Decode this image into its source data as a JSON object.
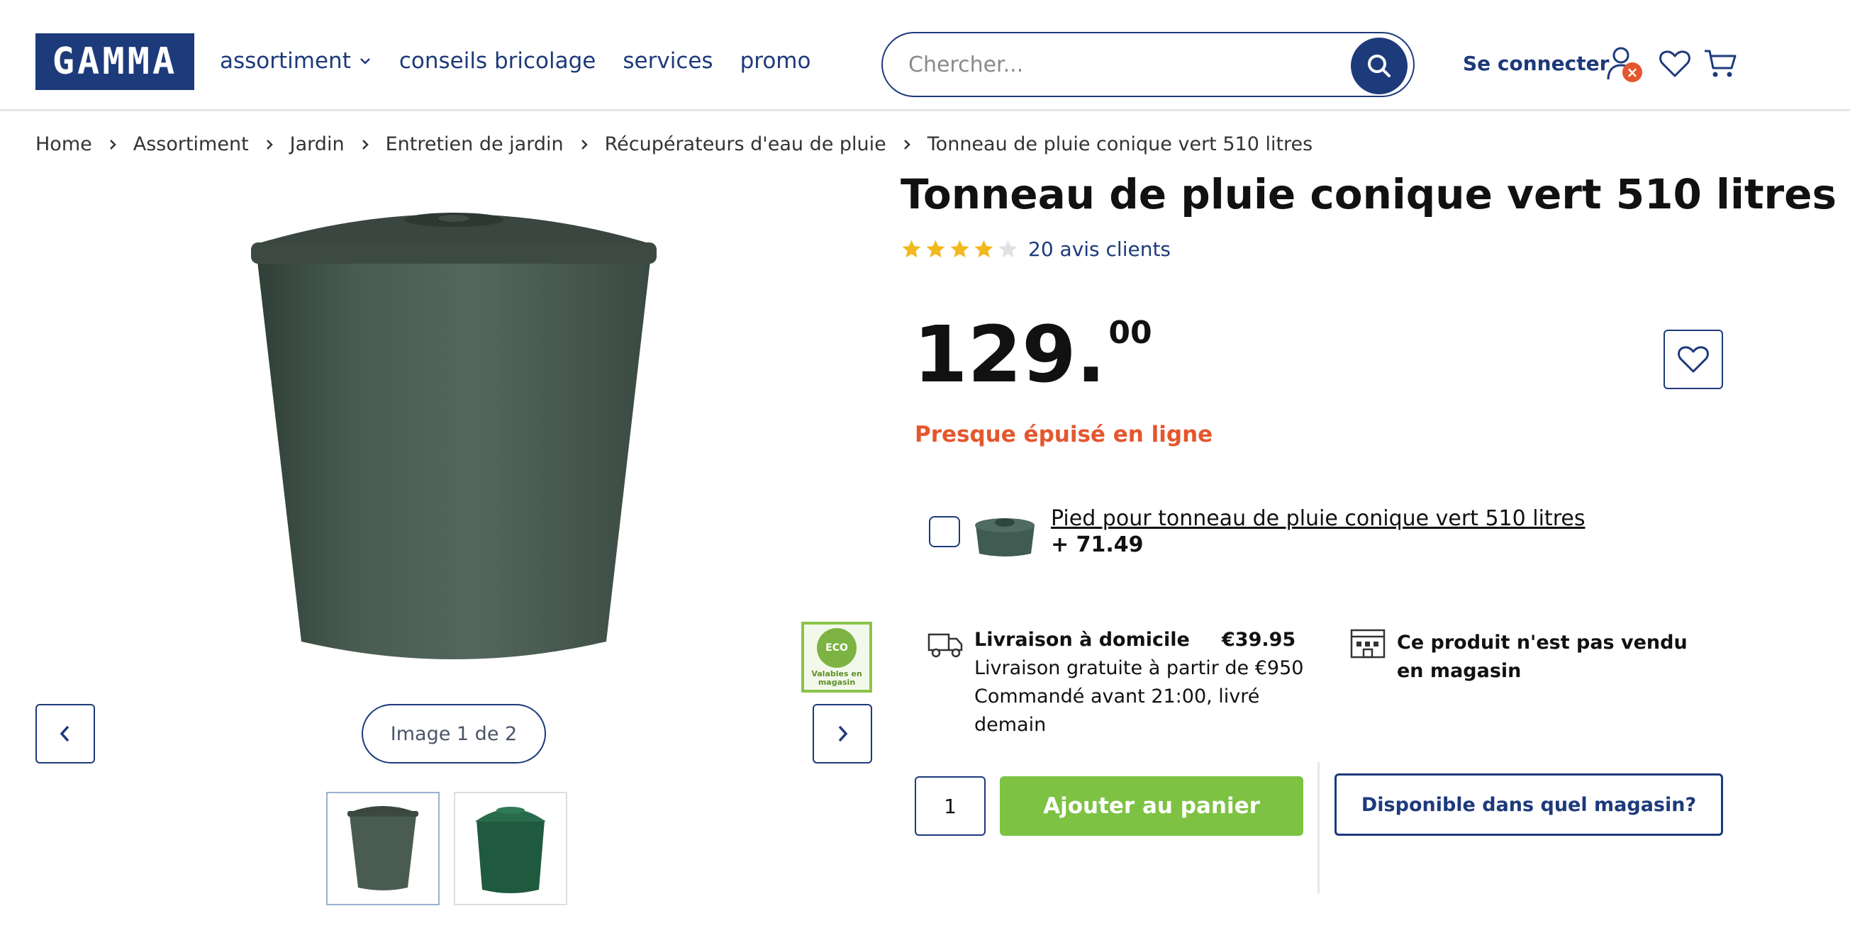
{
  "header": {
    "logo_text": "GAMMA",
    "nav": [
      {
        "label": "assortiment"
      },
      {
        "label": "conseils bricolage"
      },
      {
        "label": "services"
      },
      {
        "label": "promo"
      }
    ],
    "search_placeholder": "Chercher...",
    "login_label": "Se connecter",
    "icons": [
      "user-icon",
      "heart-icon",
      "cart-icon",
      "search-icon"
    ],
    "brand_color": "#1d3a7b"
  },
  "breadcrumb": [
    "Home",
    "Assortiment",
    "Jardin",
    "Entretien de jardin",
    "Récupérateurs d'eau de pluie",
    "Tonneau de pluie conique vert 510 litres"
  ],
  "gallery": {
    "counter": "Image 1 de 2",
    "eco_badge": {
      "logo": "ECO",
      "text": "Valables en magasin"
    }
  },
  "product": {
    "title": "Tonneau de pluie conique vert 510 litres",
    "rating": 4,
    "rating_max": 5,
    "reviews_label": "20 avis clients",
    "price_main": "129.",
    "price_cents": "00",
    "stock_status": "Presque épuisé en ligne",
    "stock_color": "#e4572e",
    "addon": {
      "name": "Pied pour tonneau de pluie conique vert 510 litres",
      "price": "+ 71.49",
      "checked": false
    },
    "delivery": {
      "title": "Livraison à domicile",
      "price": "€39.95",
      "line1": "Livraison gratuite à partir de €950",
      "line2": "Commandé avant 21:00, livré",
      "line3": "demain"
    },
    "store_note": "Ce produit n'est pas vendu en magasin",
    "quantity": "1",
    "add_to_cart": "Ajouter au panier",
    "add_to_cart_color": "#7dc242",
    "store_availability": "Disponible dans quel magasin?"
  }
}
